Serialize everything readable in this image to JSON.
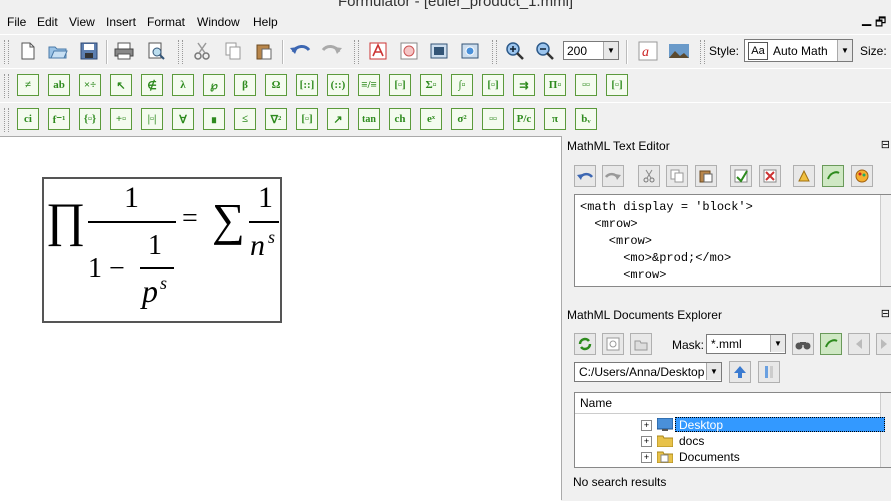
{
  "window": {
    "title": "Formulator - [euler_product_1.mml]"
  },
  "menu": [
    "File",
    "Edit",
    "View",
    "Insert",
    "Format",
    "Window",
    "Help"
  ],
  "toolbar_main": {
    "zoom_value": "200",
    "style_label": "Style:",
    "style_value": "Auto Math",
    "style_icon_text": "Aa",
    "size_label": "Size:"
  },
  "toolbar_symbols_row1": [
    "≠",
    "ab",
    "×÷",
    "↖",
    "∉",
    "λ",
    "℘",
    "β",
    "Ω",
    "[::]",
    "(::)",
    "≡/≡",
    "[▫]",
    "Σ▫",
    "∫▫",
    "[▫]",
    "⇉",
    "Π▫",
    "▫▫",
    "[▫]"
  ],
  "toolbar_symbols_row2": [
    "ci",
    "f⁻¹",
    "{▫}",
    "+▫",
    "|▫|",
    "∀",
    "∎",
    "≤",
    "∇²",
    "[▫]",
    "↗",
    "tan",
    "ch",
    "eˣ",
    "σ²",
    "▫▫",
    "P/c",
    "π",
    "bᵥ"
  ],
  "formula": {
    "prod": "∏",
    "num1": "1",
    "den_one": "1",
    "minus": "−",
    "num2": "1",
    "p": "p",
    "s_exp1": "s",
    "equals": "=",
    "sum": "∑",
    "num3": "1",
    "n": "n",
    "s_exp2": "s"
  },
  "text_editor": {
    "title": "MathML Text Editor",
    "lines": [
      "<math display = 'block'>",
      "  <mrow>",
      "    <mrow>",
      "      <mo>&prod;</mo>",
      "      <mrow>"
    ]
  },
  "explorer": {
    "title": "MathML Documents Explorer",
    "mask_label": "Mask:",
    "mask_value": "*.mml",
    "path_value": "C:/Users/Anna/Desktop",
    "column_name": "Name",
    "items": [
      {
        "label": "Desktop",
        "selected": true
      },
      {
        "label": "docs"
      },
      {
        "label": "Documents"
      }
    ],
    "status": "No search results"
  },
  "colors": {
    "accent_green": "#2e8b1e",
    "selection_blue": "#3399ff"
  }
}
